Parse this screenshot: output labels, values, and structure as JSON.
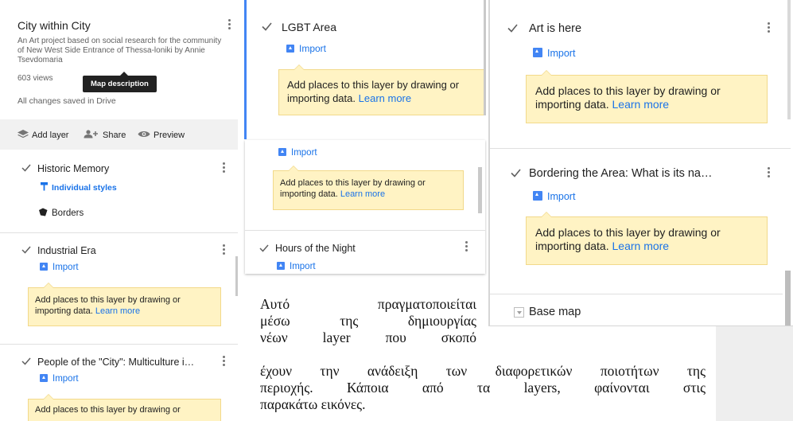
{
  "map": {
    "title": "City within City",
    "description": "An Art project based on social research for the community of New West Side Entrance of Thessa-loniki by Annie Tsevdomaria",
    "views": "603 views",
    "tooltip": "Map description",
    "save_status": "All changes saved in Drive"
  },
  "toolbar": {
    "add_layer": "Add layer",
    "share": "Share",
    "preview": "Preview"
  },
  "layers_left": [
    {
      "name": "Historic Memory",
      "styles": "Individual styles",
      "sublabel": "Borders"
    },
    {
      "name": "Industrial Era",
      "import": "Import",
      "tip": "Add places to this layer by drawing or importing data.",
      "learn": "Learn more"
    },
    {
      "name": "People of the \"City\": Multiculture i…",
      "import": "Import",
      "tip_partial": "Add places to this layer by drawing or"
    }
  ],
  "layers_middle": [
    {
      "name": "LGBT Area",
      "import": "Import",
      "tip": "Add places to this layer by drawing or importing data.",
      "learn": "Learn more"
    },
    {
      "import": "Import",
      "tip_line1": "Add places to this layer by drawing or",
      "tip_line2": "importing data.",
      "learn": "Learn more"
    },
    {
      "name": "Hours of the Night",
      "import": "Import"
    }
  ],
  "layers_right": [
    {
      "name": "Art is here",
      "import": "Import",
      "tip_line1": "Add places to this layer by drawing or",
      "tip_line2": "importing data.",
      "learn": "Learn more"
    },
    {
      "name": "Bordering the Area: What is its na…",
      "import": "Import",
      "tip_line1": "Add places to this layer by drawing or",
      "tip_line2": "importing data.",
      "learn": "Learn more"
    }
  ],
  "base_map": "Base map",
  "caption": {
    "line1": "Αυτό πραγματοποιείται",
    "line2": "μέσω της δημιουργίας",
    "line3": "νέων layer που σκοπό",
    "line4": "έχουν την ανάδειξη των διαφορετικών ποιοτήτων της",
    "line5": "περιοχής. Κάποια από τα layers, φαίνονται στις",
    "line6": "παρακάτω εικόνες."
  },
  "colors": {
    "accent": "#1a73e8",
    "tip_bg": "#fff3c4",
    "selected_bar": "#4285f4",
    "side_bg": "#eeeeee"
  }
}
